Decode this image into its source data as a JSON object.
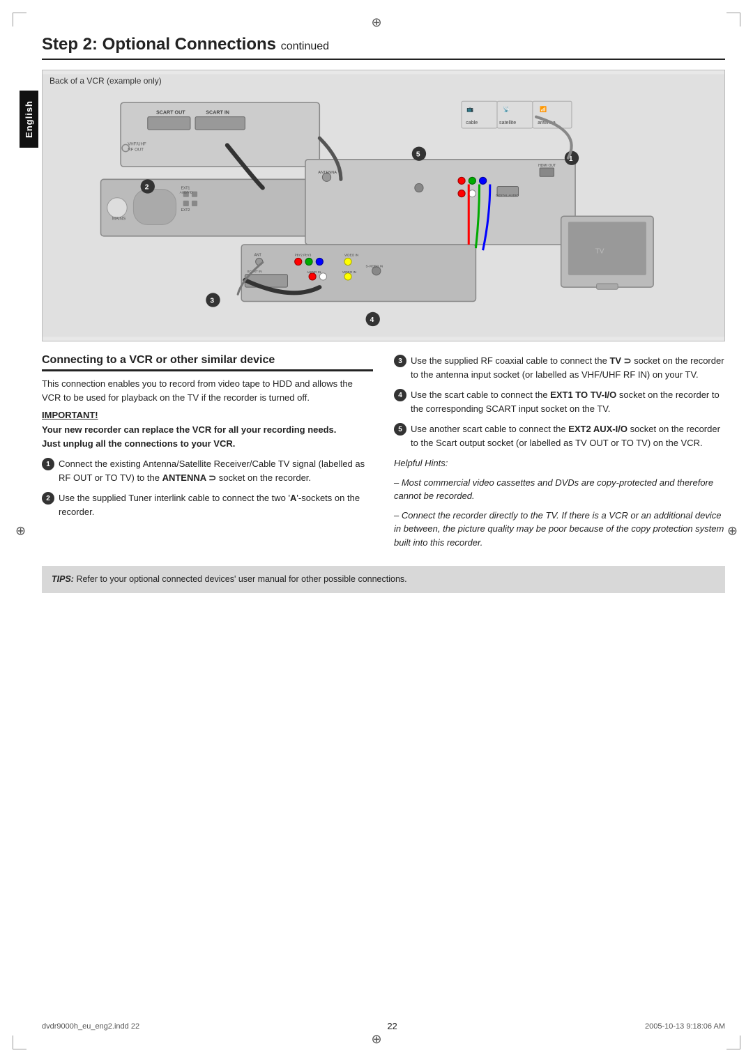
{
  "page": {
    "title": "Step 2: Optional Connections",
    "title_continued": "continued",
    "page_number": "22",
    "footer_left": "dvdr9000h_eu_eng2.indd  22",
    "footer_right": "2005-10-13  9:18:06 AM"
  },
  "english_tab": "English",
  "diagram": {
    "label": "Back of a VCR (example only)",
    "icons": [
      "cable",
      "satellite",
      "antenna"
    ]
  },
  "left_col": {
    "heading": "Connecting to a VCR or other similar device",
    "body": "This connection enables you to record from video tape to HDD and allows the VCR to be used for playback on the TV if the recorder is turned off.",
    "important_label": "IMPORTANT!",
    "important_lines": [
      "Your new recorder can replace the VCR for all your recording needs.",
      "Just unplug all the connections to your VCR."
    ],
    "steps": [
      {
        "num": "1",
        "text": "Connect the existing Antenna/Satellite Receiver/Cable TV signal (labelled as RF OUT or TO TV) to the ",
        "bold": "ANTENNA",
        "after_bold": " socket on the recorder.",
        "antenna_symbol": true
      },
      {
        "num": "2",
        "text": "Use the supplied Tuner interlink cable to connect the two '",
        "bold": "A",
        "after_bold": "'-sockets on the recorder."
      }
    ]
  },
  "right_col": {
    "steps": [
      {
        "num": "3",
        "text": "Use the supplied RF coaxial cable to connect the ",
        "bold": "TV",
        "after_bold": " socket on the recorder to the antenna input socket (or labelled as VHF/UHF RF IN) on your TV.",
        "tv_symbol": true
      },
      {
        "num": "4",
        "text": "Use the scart cable to connect the ",
        "bold": "EXT1 TO TV-I/O",
        "after_bold": " socket on the recorder to the corresponding SCART input socket on the TV."
      },
      {
        "num": "5",
        "text": "Use another scart cable to connect the ",
        "bold": "EXT2 AUX-I/O",
        "after_bold": " socket on the recorder to the Scart output socket (or labelled as TV OUT or TO TV) on the VCR."
      }
    ],
    "hints_label": "Helpful Hints:",
    "hints": [
      "– Most commercial video cassettes and DVDs are copy-protected and therefore cannot be recorded.",
      "– Connect the recorder directly to the TV. If there is a VCR or an additional device in between, the picture quality may be poor because of the copy protection system built into this recorder."
    ]
  },
  "tips": {
    "label": "TIPS:",
    "text": "Refer to your optional connected devices' user manual for other possible connections."
  }
}
